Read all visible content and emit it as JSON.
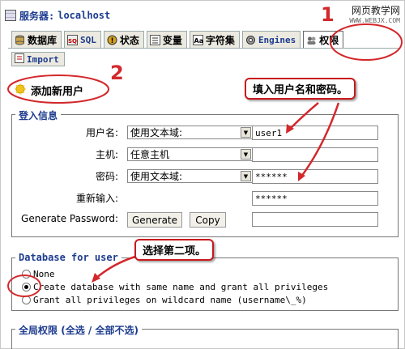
{
  "server": {
    "label": "服务器:",
    "host": "localhost"
  },
  "watermark": {
    "site": "网页教学网",
    "url": "WWW.WEBJX.COM"
  },
  "tabs": [
    {
      "label": "数据库",
      "icon": "database-icon"
    },
    {
      "label": "SQL",
      "icon": "sql-icon"
    },
    {
      "label": "状态",
      "icon": "status-icon"
    },
    {
      "label": "变量",
      "icon": "variables-icon"
    },
    {
      "label": "字符集",
      "icon": "charset-icon"
    },
    {
      "label": "Engines",
      "icon": "engines-icon"
    },
    {
      "label": "权限",
      "icon": "privileges-icon"
    }
  ],
  "import_tab": {
    "label": "Import",
    "icon": "import-icon"
  },
  "add_user": {
    "title": "添加新用户",
    "icon": "add-user-icon"
  },
  "login": {
    "legend": "登入信息",
    "username": {
      "label": "用户名:",
      "mode": "使用文本域:",
      "value": "user1"
    },
    "host": {
      "label": "主机:",
      "mode": "任意主机",
      "value": ""
    },
    "password": {
      "label": "密码:",
      "mode": "使用文本域:",
      "value": "******"
    },
    "retype": {
      "label": "重新输入:",
      "value": "******"
    },
    "generate": {
      "label": "Generate Password:",
      "generate_button": "Generate",
      "copy_button": "Copy",
      "value": ""
    }
  },
  "database": {
    "legend": "Database for user",
    "options": [
      {
        "label": "None",
        "selected": false
      },
      {
        "label": "Create database with same name and grant all privileges",
        "selected": true
      },
      {
        "label": "Grant all privileges on wildcard name (username\\_%)",
        "selected": false
      }
    ]
  },
  "global": {
    "legend": "全局权限",
    "select_all": "(全选",
    "sep": "/",
    "deselect_all": "全部不选)"
  },
  "annotations": {
    "step1": "1",
    "step2": "2",
    "fill_note": "填入用户名和密码。",
    "option_note": "选择第二项。"
  },
  "colors": {
    "accent": "#1d3c8f",
    "annotation": "#d3282c"
  }
}
